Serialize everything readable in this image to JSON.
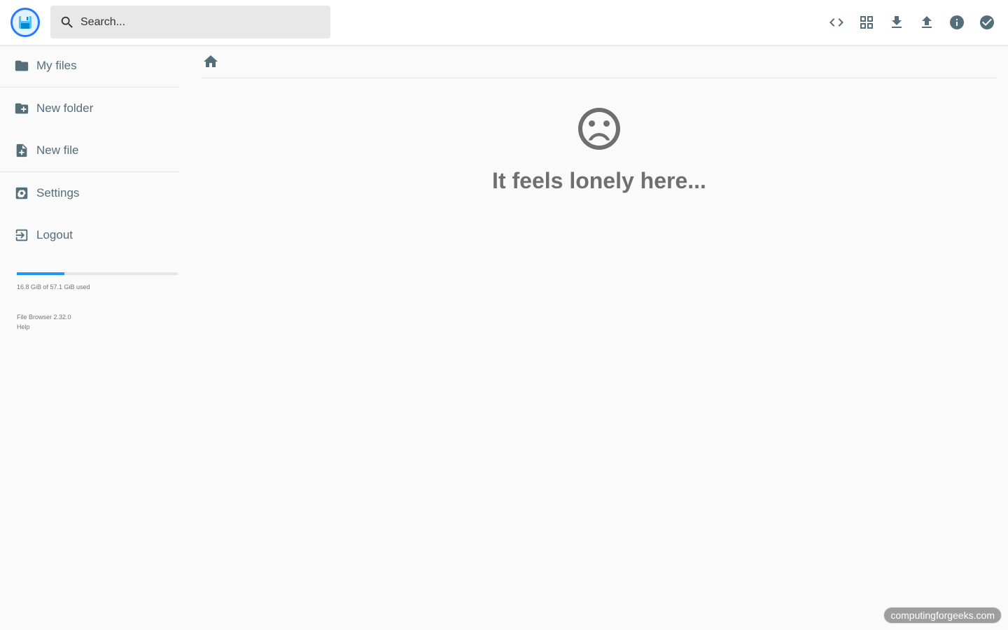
{
  "header": {
    "logo_icon": "floppy-disk-icon",
    "search": {
      "placeholder": "Search...",
      "value": ""
    },
    "actions": [
      {
        "name": "switch-view-code-icon"
      },
      {
        "name": "grid-view-icon"
      },
      {
        "name": "download-icon"
      },
      {
        "name": "upload-icon"
      },
      {
        "name": "info-icon"
      },
      {
        "name": "select-all-check-icon"
      }
    ]
  },
  "sidebar": {
    "items": [
      {
        "label": "My files",
        "icon": "folder-icon"
      },
      {
        "label": "New folder",
        "icon": "create-new-folder-icon"
      },
      {
        "label": "New file",
        "icon": "note-add-icon"
      },
      {
        "label": "Settings",
        "icon": "settings-icon"
      },
      {
        "label": "Logout",
        "icon": "exit-icon"
      }
    ],
    "quota": {
      "text": "16.8 GiB of 57.1 GiB used",
      "used_fraction": 0.294
    },
    "credits": {
      "version": "File Browser 2.32.0",
      "help": "Help"
    }
  },
  "main": {
    "empty_message": "It feels lonely here...",
    "empty_icon": "sad-face-icon"
  },
  "watermark": "computingforgeeks.com",
  "colors": {
    "accent": "#2196f3",
    "icon": "#546e7a",
    "logo_ring": "#2979ff"
  }
}
